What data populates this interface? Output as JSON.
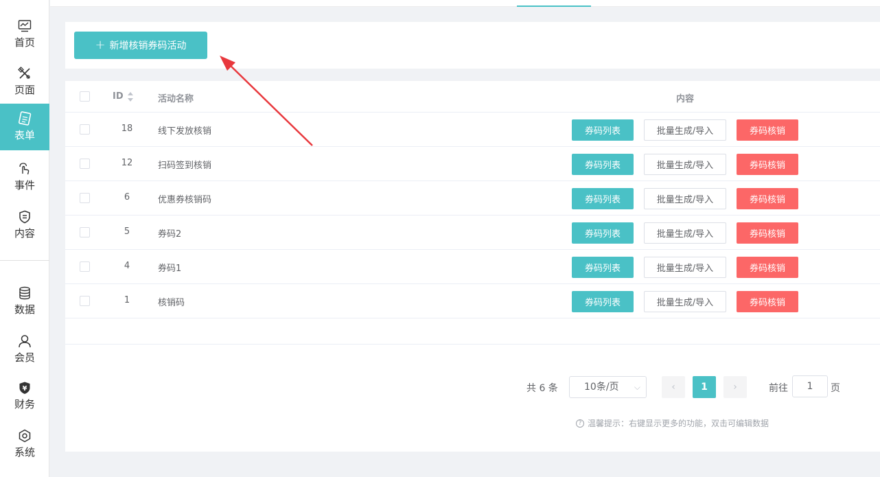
{
  "sidebar": {
    "items": [
      {
        "label": "首页",
        "icon": "dashboard-icon"
      },
      {
        "label": "页面",
        "icon": "design-tools-icon"
      },
      {
        "label": "表单",
        "icon": "form-icon",
        "active": true
      },
      {
        "label": "事件",
        "icon": "touch-icon"
      },
      {
        "label": "内容",
        "icon": "content-shield-icon"
      },
      {
        "label": "数据",
        "icon": "database-icon"
      },
      {
        "label": "会员",
        "icon": "user-icon"
      },
      {
        "label": "财务",
        "icon": "finance-icon"
      },
      {
        "label": "系统",
        "icon": "settings-hex-icon"
      }
    ]
  },
  "toolbar": {
    "add_label": "新增核销券码活动",
    "add_icon": "plus"
  },
  "table": {
    "headers": {
      "id": "ID",
      "name": "活动名称",
      "content": "内容"
    },
    "actions": {
      "list": "券码列表",
      "generate": "批量生成/导入",
      "verify": "券码核销"
    },
    "rows": [
      {
        "id": "18",
        "name": "线下发放核销"
      },
      {
        "id": "12",
        "name": "扫码签到核销"
      },
      {
        "id": "6",
        "name": "优惠券核销码"
      },
      {
        "id": "5",
        "name": "券码2"
      },
      {
        "id": "4",
        "name": "券码1"
      },
      {
        "id": "1",
        "name": "核销码"
      }
    ]
  },
  "pagination": {
    "total": "共 6 条",
    "page_size": "10条/页",
    "prev": "‹",
    "current": "1",
    "next": "›",
    "goto_label": "前往",
    "goto_value": "1",
    "goto_suffix": "页"
  },
  "tip": "温馨提示：右键显示更多的功能，双击可编辑数据",
  "colors": {
    "accent": "#4ac1c6",
    "danger": "#fc6767",
    "annotation": "#e8383d"
  }
}
